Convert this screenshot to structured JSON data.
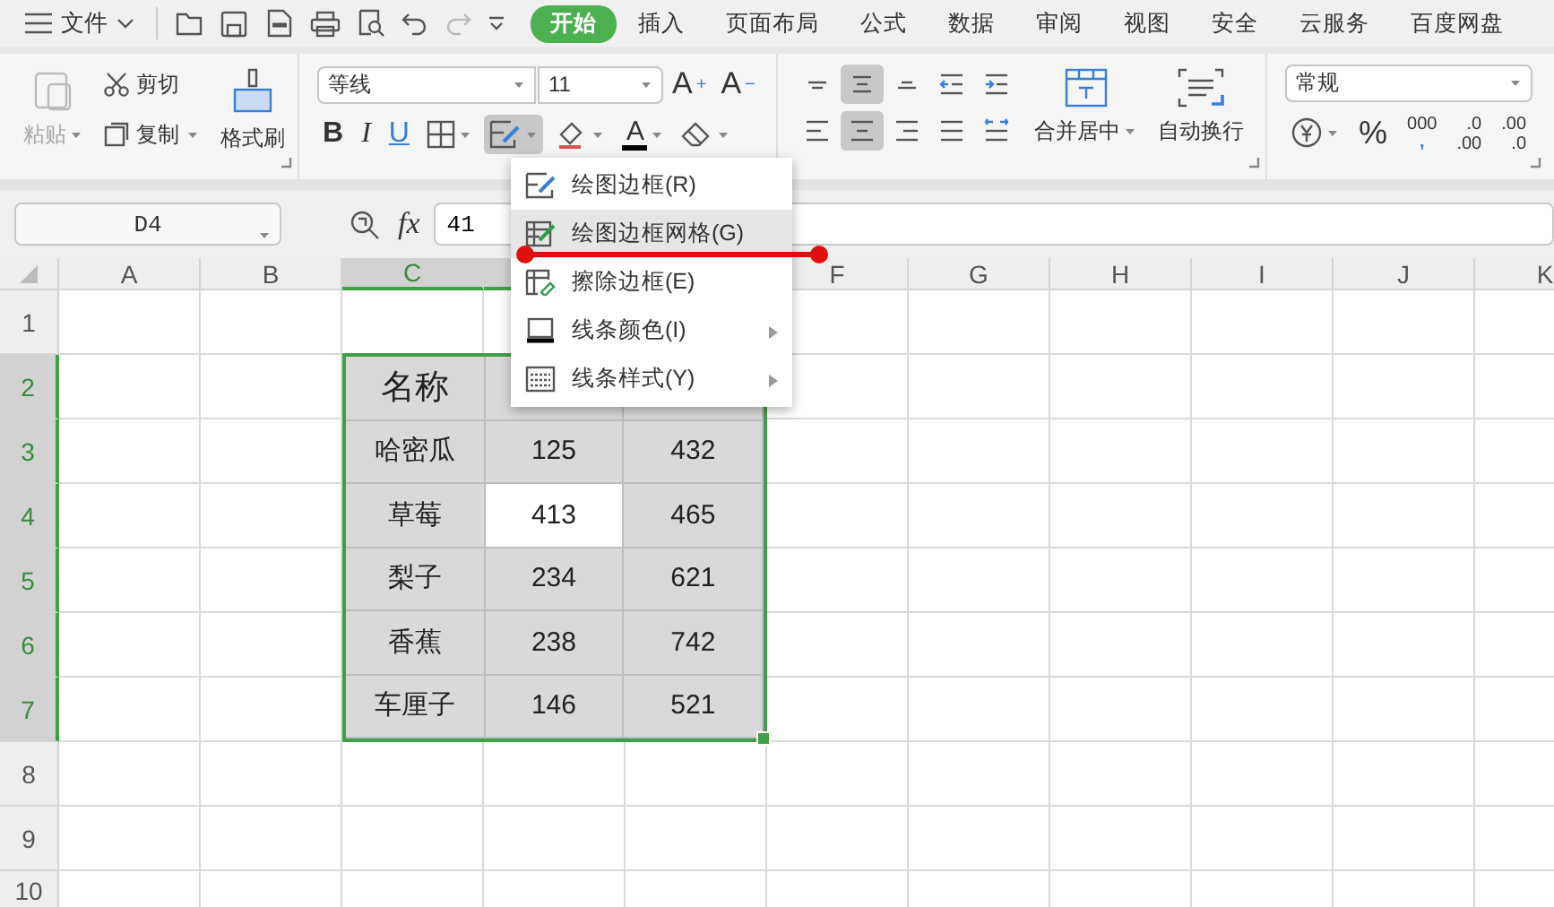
{
  "menubar": {
    "file_label": "文件",
    "tabs": [
      {
        "label": "开始",
        "selected": true
      },
      {
        "label": "插入",
        "selected": false
      },
      {
        "label": "页面布局",
        "selected": false
      },
      {
        "label": "公式",
        "selected": false
      },
      {
        "label": "数据",
        "selected": false
      },
      {
        "label": "审阅",
        "selected": false
      },
      {
        "label": "视图",
        "selected": false
      },
      {
        "label": "安全",
        "selected": false
      },
      {
        "label": "云服务",
        "selected": false
      },
      {
        "label": "百度网盘",
        "selected": false
      }
    ]
  },
  "ribbon": {
    "clipboard": {
      "paste": {
        "label": "粘贴",
        "disabled": true
      },
      "cut": "剪切",
      "copy": "复制",
      "format_painter": "格式刷"
    },
    "font": {
      "name": "等线",
      "size": "11",
      "grow": {
        "label": "A",
        "sign": "+"
      },
      "shrink": {
        "label": "A",
        "sign": "−"
      },
      "styles": [
        {
          "kind": "bold",
          "label": "B"
        },
        {
          "kind": "italic",
          "label": "I"
        },
        {
          "kind": "underline",
          "label": "U"
        }
      ],
      "tools": [
        {
          "kind": "borders",
          "selected": false
        },
        {
          "kind": "draw_border",
          "selected": true
        },
        {
          "kind": "fill",
          "selected": false
        },
        {
          "kind": "font_color",
          "label": "A",
          "selected": false
        },
        {
          "kind": "eraser",
          "selected": false
        }
      ]
    },
    "alignment": {
      "top_row": [
        {
          "kind": "top",
          "selected": false
        },
        {
          "kind": "middle",
          "selected": true
        },
        {
          "kind": "bottom",
          "selected": false
        },
        {
          "kind": "outdent",
          "selected": false
        },
        {
          "kind": "indent",
          "selected": false
        }
      ],
      "bottom_row": [
        {
          "kind": "left",
          "selected": false
        },
        {
          "kind": "center",
          "selected": true
        },
        {
          "kind": "right",
          "selected": false
        },
        {
          "kind": "justify",
          "selected": false
        },
        {
          "kind": "distribute",
          "selected": false
        }
      ],
      "merge": "合并居中",
      "wrap": "自动换行"
    },
    "number": {
      "format": "常规",
      "buttons": [
        {
          "kind": "currency"
        },
        {
          "kind": "percent",
          "label": "%"
        },
        {
          "kind": "thousands",
          "label": "000",
          "mark": ","
        },
        {
          "kind": "more_decimals",
          "top": ".0",
          "bottom": ".00"
        },
        {
          "kind": "fewer_decimals",
          "top": ".00",
          "bottom": ".0"
        }
      ]
    }
  },
  "formula_bar": {
    "name_box": "D4",
    "fx": "fx",
    "value": "41"
  },
  "sheet": {
    "columns": [
      {
        "label": "A",
        "selected": false
      },
      {
        "label": "B",
        "selected": false
      },
      {
        "label": "C",
        "selected": true
      },
      {
        "label": "F",
        "selected": false
      },
      {
        "label": "G",
        "selected": false
      },
      {
        "label": "H",
        "selected": false
      },
      {
        "label": "I",
        "selected": false
      },
      {
        "label": "J",
        "selected": false
      },
      {
        "label": "K",
        "selected": false
      }
    ],
    "rows": [
      {
        "label": "1",
        "selected": false
      },
      {
        "label": "2",
        "selected": true
      },
      {
        "label": "3",
        "selected": true
      },
      {
        "label": "4",
        "selected": true
      },
      {
        "label": "5",
        "selected": true
      },
      {
        "label": "6",
        "selected": true
      },
      {
        "label": "7",
        "selected": true
      },
      {
        "label": "8",
        "selected": false
      },
      {
        "label": "9",
        "selected": false
      },
      {
        "label": "10",
        "selected": false
      }
    ],
    "table": {
      "rows": [
        [
          {
            "text": "名称",
            "selected": false
          }
        ],
        [
          {
            "text": "哈密瓜",
            "selected": false
          },
          {
            "text": "125",
            "selected": false
          },
          {
            "text": "432",
            "selected": false
          }
        ],
        [
          {
            "text": "草莓",
            "selected": false
          },
          {
            "text": "413",
            "selected": true
          },
          {
            "text": "465",
            "selected": false
          }
        ],
        [
          {
            "text": "梨子",
            "selected": false
          },
          {
            "text": "234",
            "selected": false
          },
          {
            "text": "621",
            "selected": false
          }
        ],
        [
          {
            "text": "香蕉",
            "selected": false
          },
          {
            "text": "238",
            "selected": false
          },
          {
            "text": "742",
            "selected": false
          }
        ],
        [
          {
            "text": "车厘子",
            "selected": false
          },
          {
            "text": "146",
            "selected": false
          },
          {
            "text": "521",
            "selected": false
          }
        ]
      ]
    }
  },
  "context_menu": {
    "items": [
      {
        "kind": "draw",
        "label": "绘图边框(R)",
        "selected": false,
        "submenu": false
      },
      {
        "kind": "grid",
        "label": "绘图边框网格(G)",
        "selected": true,
        "submenu": false
      },
      {
        "kind": "erase",
        "label": "擦除边框(E)",
        "selected": false,
        "submenu": false
      },
      {
        "kind": "color",
        "label": "线条颜色(I)",
        "selected": false,
        "submenu": true
      },
      {
        "kind": "style",
        "label": "线条样式(Y)",
        "selected": false,
        "submenu": true
      }
    ]
  }
}
